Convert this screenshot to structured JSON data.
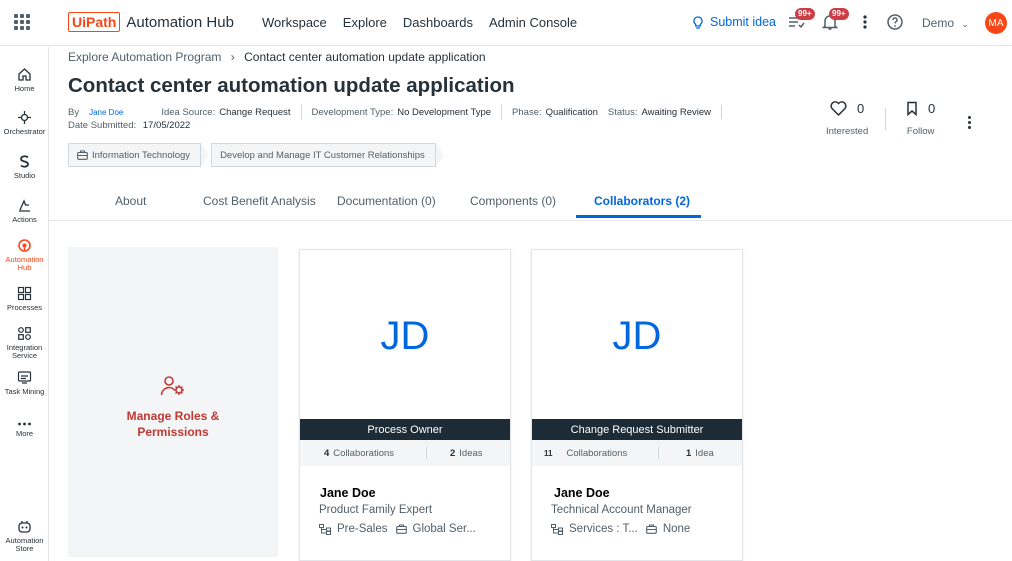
{
  "app": {
    "logo_mark": "UiPath",
    "logo_text": "Automation Hub"
  },
  "topnav": [
    "Workspace",
    "Explore",
    "Dashboards",
    "Admin Console"
  ],
  "header": {
    "submit_idea": "Submit idea",
    "tasks_badge": "99+",
    "notifications_badge": "99+",
    "tenant": "Demo",
    "user_initials": "MA"
  },
  "rail": [
    {
      "label": "Home",
      "icon": "home-icon"
    },
    {
      "label": "Orchestrator",
      "icon": "orchestrator-icon"
    },
    {
      "label": "Studio",
      "icon": "studio-icon"
    },
    {
      "label": "Actions",
      "icon": "actions-icon"
    },
    {
      "label": "Automation Hub",
      "icon": "automation-hub-icon",
      "active": true
    },
    {
      "label": "Processes",
      "icon": "processes-icon"
    },
    {
      "label": "Integration Service",
      "icon": "integration-service-icon"
    },
    {
      "label": "Task Mining",
      "icon": "task-mining-icon"
    },
    {
      "label": "More",
      "icon": "more-icon"
    },
    {
      "label": "Automation Store",
      "icon": "automation-store-icon"
    }
  ],
  "breadcrumb": {
    "parent": "Explore Automation Program",
    "current": "Contact center automation update application"
  },
  "page": {
    "title": "Contact center automation update application",
    "by_label": "By",
    "by_value": "Jane Doe",
    "source_label": "Idea Source:",
    "source_value": "Change Request",
    "devtype_label": "Development Type:",
    "devtype_value": "No Development Type",
    "phase_label": "Phase:",
    "phase_value": "Qualification",
    "status_label": "Status:",
    "status_value": "Awaiting Review",
    "date_label": "Date Submitted:",
    "date_value": "17/05/2022"
  },
  "stats": {
    "interested_count": "0",
    "interested_label": "Interested",
    "follow_count": "0",
    "follow_label": "Follow"
  },
  "tags": [
    "Information Technology",
    "Develop and Manage IT Customer Relationships"
  ],
  "tabs": [
    "About",
    "Cost Benefit Analysis",
    "Documentation (0)",
    "Components (0)",
    "Collaborators (2)"
  ],
  "manage_roles": "Manage Roles & Permissions",
  "collaborators": [
    {
      "initials": "JD",
      "role": "Process Owner",
      "collab_count": "4",
      "collab_label": "Collaborations",
      "ideas_count": "2",
      "ideas_label": "Ideas",
      "name": "Jane Doe",
      "job": "Product Family Expert",
      "department": "Pre-Sales",
      "location": "Global Ser..."
    },
    {
      "initials": "JD",
      "role": "Change Request Submitter",
      "collab_count": "11",
      "collab_label": "Collaborations",
      "ideas_count": "1",
      "ideas_label": "Idea",
      "name": "Jane Doe",
      "job": "Technical Account Manager",
      "department": "Services : T...",
      "location": "None"
    }
  ],
  "colors": {
    "accent": "#0067df",
    "brand": "#fa4616",
    "role_bar": "#1c2b36",
    "manage_text": "#c23934"
  }
}
